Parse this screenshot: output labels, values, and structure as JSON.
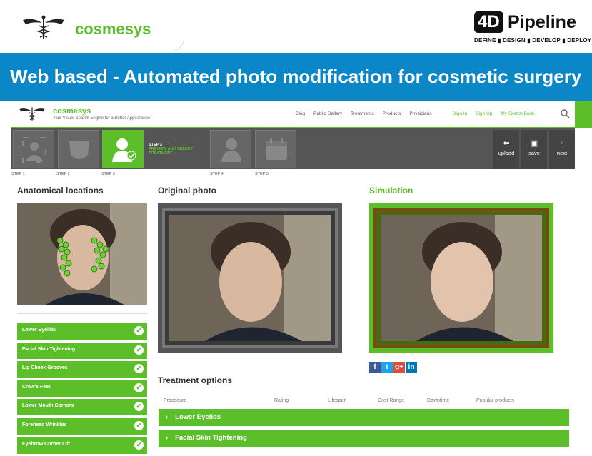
{
  "header": {
    "brand": "cosmesys",
    "partner": {
      "badge": "4D",
      "word": "Pipeline",
      "tagline": "DEFINE ▮ DESIGN ▮ DEVELOP ▮ DEPLOY"
    }
  },
  "banner": {
    "title": "Web based - Automated photo modification for cosmetic surgery"
  },
  "nav": {
    "brand": "cosmesys",
    "tagline": "Your Visual Search Engine for a Better Appearance",
    "links": [
      "Blog",
      "Public Gallery",
      "Treatments",
      "Products",
      "Physicians"
    ],
    "auth": [
      "Sign In",
      "Sign Up",
      "My Sketch Book"
    ]
  },
  "steps": {
    "labels": [
      "STEP 1",
      "STEP 2",
      "STEP 3",
      "STEP 4",
      "STEP 5"
    ],
    "active_step": "STEP 3",
    "active_text": "PREVIEW AND SELECT TREATMENT",
    "actions": {
      "upload": "upload",
      "save": "save",
      "next": "next"
    }
  },
  "sections": {
    "anatomical": "Anatomical locations",
    "original": "Original photo",
    "simulation": "Simulation",
    "treatment": "Treatment options"
  },
  "locations": [
    "Lower Eyelids",
    "Facial Skin Tightening",
    "Lip Cheek Grooves",
    "Crow's Feet",
    "Lower Mouth Corners",
    "Forehead Wrinkles",
    "Eyebrow Corner Lift"
  ],
  "social": [
    "f",
    "t",
    "g+",
    "in"
  ],
  "treatment_table": {
    "columns": [
      "Procedure",
      "Rating",
      "Lifespan",
      "Cost Range",
      "Downtime",
      "Popular products"
    ],
    "rows": [
      "Lower Eyelids",
      "Facial Skin Tightening"
    ]
  },
  "colors": {
    "green": "#5cbf2a",
    "blue": "#0b86c6"
  }
}
